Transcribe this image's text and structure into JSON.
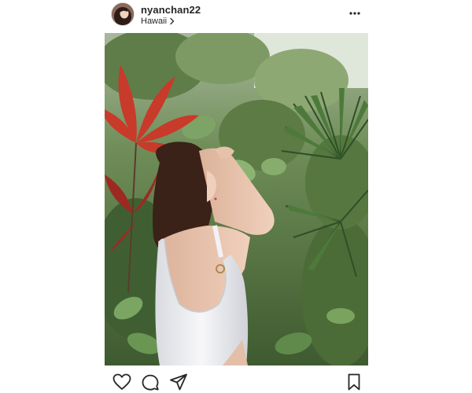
{
  "post": {
    "username": "nyanchan22",
    "location": "Hawaii"
  },
  "icons": {
    "avatar": "profile-avatar",
    "more": "more-options-icon",
    "location_chevron": "chevron-right-icon",
    "like": "heart-icon",
    "comment": "comment-icon",
    "share": "paper-plane-icon",
    "save": "bookmark-icon"
  },
  "colors": {
    "text": "#262626",
    "border": "#dbdbdb",
    "background": "#ffffff"
  }
}
